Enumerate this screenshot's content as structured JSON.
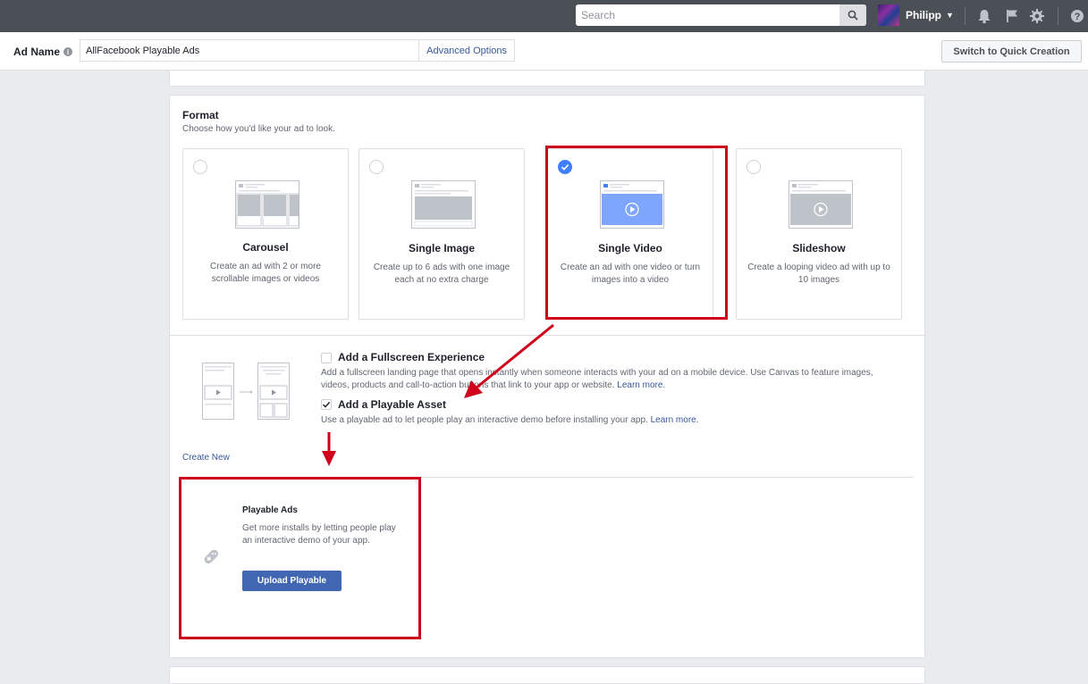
{
  "topbar": {
    "search_placeholder": "Search",
    "user_name": "Philipp",
    "icons": [
      "search-icon",
      "bell-icon",
      "flag-icon",
      "gear-icon",
      "help-icon"
    ]
  },
  "namebar": {
    "label": "Ad Name",
    "value": "AllFacebook Playable Ads",
    "advanced": "Advanced Options",
    "switch": "Switch to Quick Creation"
  },
  "format": {
    "title": "Format",
    "subtitle": "Choose how you'd like your ad to look.",
    "selected_index": 2,
    "options": [
      {
        "title": "Carousel",
        "desc": "Create an ad with 2 or more scrollable images or videos"
      },
      {
        "title": "Single Image",
        "desc": "Create up to 6 ads with one image each at no extra charge"
      },
      {
        "title": "Single Video",
        "desc": "Create an ad with one video or turn images into a video"
      },
      {
        "title": "Slideshow",
        "desc": "Create a looping video ad with up to 10 images"
      }
    ]
  },
  "fullscreen": {
    "title": "Add a Fullscreen Experience",
    "desc": "Add a fullscreen landing page that opens instantly when someone interacts with your ad on a mobile device. Use Canvas to feature images, videos, products and call-to-action buttons that link to your app or website.",
    "link": "Learn more.",
    "checked": false
  },
  "playable_asset": {
    "title": "Add a Playable Asset",
    "desc": "Use a playable ad to let people play an interactive demo before installing your app.",
    "link": "Learn more.",
    "checked": true
  },
  "create_new": "Create New",
  "playable_ads": {
    "title": "Playable Ads",
    "desc": "Get more installs by letting people play an interactive demo of your app.",
    "button": "Upload Playable"
  },
  "colors": {
    "topbar": "#4b4f56",
    "accent": "#4080ff",
    "button": "#4267b2",
    "annotation": "#d0021b",
    "link": "#365899"
  }
}
